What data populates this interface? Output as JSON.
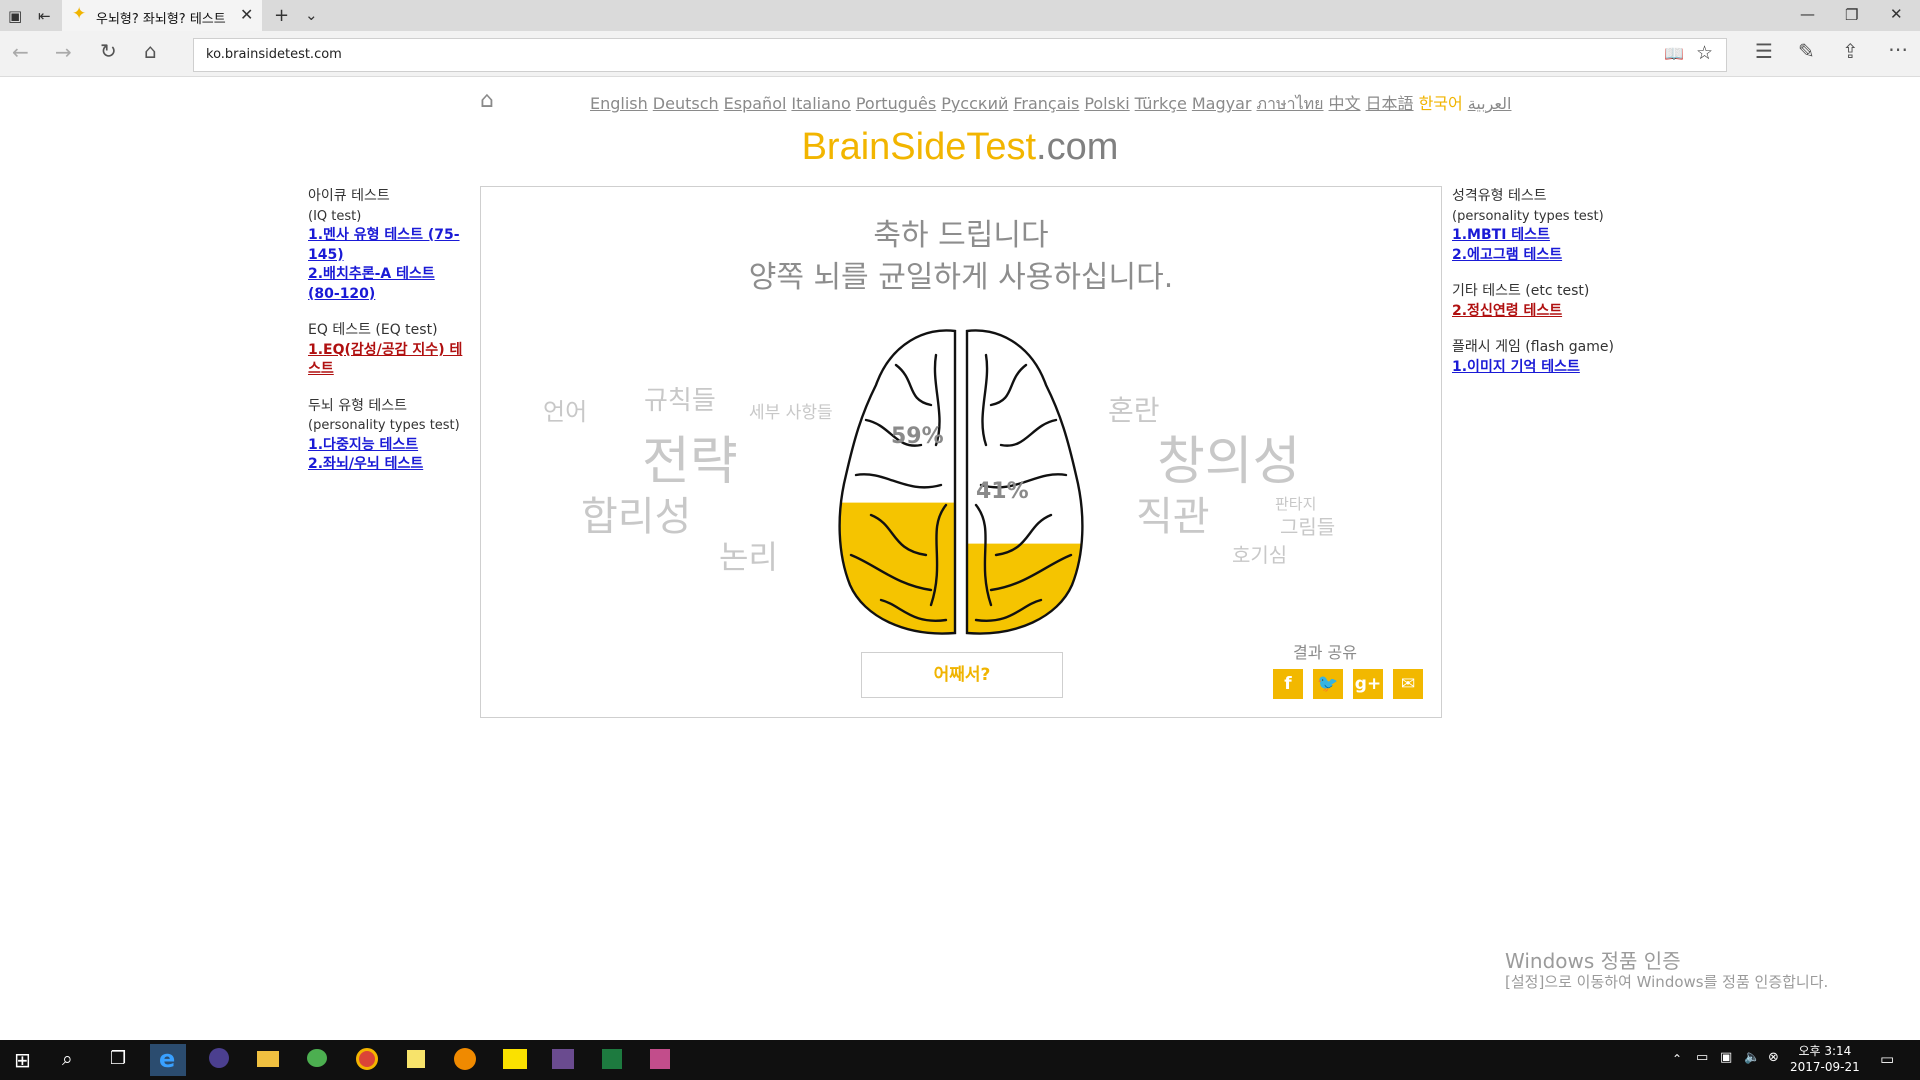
{
  "browser": {
    "tab_title": "우뇌형? 좌뇌형? 테스트",
    "url": "ko.brainsidetest.com"
  },
  "page": {
    "languages": [
      "English",
      "Deutsch",
      "Español",
      "Italiano",
      "Português",
      "Русский",
      "Français",
      "Polski",
      "Türkçe",
      "Magyar",
      "ภาษาไทย",
      "中文",
      "日本語",
      "한국어",
      "العربية"
    ],
    "active_language": "한국어",
    "site_brand": "BrainSideTest",
    "site_domain": ".com",
    "left_sidebar": [
      {
        "heading": "아이큐 테스트",
        "sub": "(IQ test)",
        "links": [
          {
            "label": "1.멘사 유형 테스트 (75-145)",
            "color": "blue"
          },
          {
            "label": "2.배치추론-A 테스트 (80-120)",
            "color": "blue"
          }
        ]
      },
      {
        "heading": "EQ 테스트 (EQ test)",
        "sub": "",
        "links": [
          {
            "label": "1.EQ(감성/공감 지수) 테스트",
            "color": "red"
          }
        ]
      },
      {
        "heading": "두뇌 유형 테스트",
        "sub": "(personality types test)",
        "links": [
          {
            "label": "1.다중지능 테스트",
            "color": "blue"
          },
          {
            "label": "2.좌뇌/우뇌 테스트",
            "color": "blue"
          }
        ]
      }
    ],
    "right_sidebar": [
      {
        "heading": "성격유형 테스트",
        "sub": "(personality types test)",
        "links": [
          {
            "label": "1.MBTI 테스트",
            "color": "blue"
          },
          {
            "label": "2.에고그램 테스트",
            "color": "blue"
          }
        ]
      },
      {
        "heading": "기타 테스트 (etc test)",
        "sub": "",
        "links": [
          {
            "label": "2.정신연령 테스트",
            "color": "red"
          }
        ]
      },
      {
        "heading": "플래시 게임 (flash game)",
        "sub": "",
        "links": [
          {
            "label": "1.이미지 기억 테스트",
            "color": "blue"
          }
        ]
      }
    ],
    "result": {
      "line1": "축하 드립니다",
      "line2": "양쪽 뇌를 균일하게 사용하십니다.",
      "left_percent": "59%",
      "right_percent": "41%",
      "left_fill": 0.59,
      "right_fill": 0.41,
      "left_words": [
        "언어",
        "규칙들",
        "세부 사항들",
        "전략",
        "합리성",
        "논리"
      ],
      "right_words": [
        "혼란",
        "창의성",
        "직관",
        "판타지",
        "그림들",
        "호기심"
      ],
      "why_button": "어째서?",
      "share_label": "결과 공유"
    },
    "colors": {
      "accent": "#f2b800",
      "link_blue": "#1a1ad6",
      "link_red": "#b01010"
    }
  },
  "watermark": {
    "title": "Windows 정품 인증",
    "subtitle": "[설정]으로 이동하여 Windows를 정품 인증합니다."
  },
  "taskbar": {
    "time": "오후 3:14",
    "date": "2017-09-21"
  }
}
